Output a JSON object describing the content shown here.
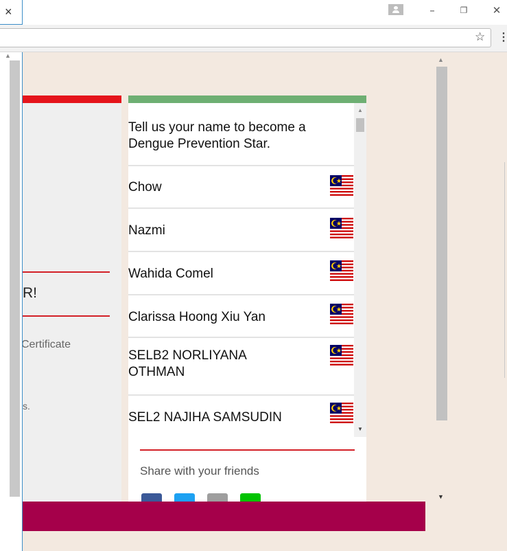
{
  "window": {
    "tab_close": "×",
    "minimize": "–",
    "restore": "❐",
    "close": "✕",
    "profile_icon": "person-icon"
  },
  "toolbar": {
    "bookmark_icon": "☆",
    "menu_icon": "⋮"
  },
  "left_panel": {
    "heading_partial": "R!",
    "text_line1": "Certificate",
    "text_line2": "s."
  },
  "names_panel": {
    "intro": "Tell us your name to become a Dengue Prevention Star.",
    "entries": [
      {
        "name": "Chow",
        "flag": "malaysia-flag"
      },
      {
        "name": "Nazmi",
        "flag": "malaysia-flag"
      },
      {
        "name": "Wahida Comel",
        "flag": "malaysia-flag"
      },
      {
        "name": "Clarissa Hoong Xiu Yan",
        "flag": "malaysia-flag"
      },
      {
        "name": "SELB2 NORLIYANA OTHMAN",
        "flag": "malaysia-flag"
      },
      {
        "name": "SEL2 NAJIHA SAMSUDIN",
        "flag": "malaysia-flag"
      }
    ]
  },
  "share": {
    "label": "Share with your friends",
    "buttons": [
      "facebook-icon",
      "twitter-icon",
      "email-icon",
      "line-icon"
    ]
  },
  "colors": {
    "page_bg": "#f3e9e0",
    "red_accent": "#e5141b",
    "green_accent": "#6eaf73",
    "footer": "#a5004a",
    "facebook": "#3b5998",
    "twitter": "#1da1f2",
    "email": "#9e9e9e",
    "line": "#00c300"
  }
}
